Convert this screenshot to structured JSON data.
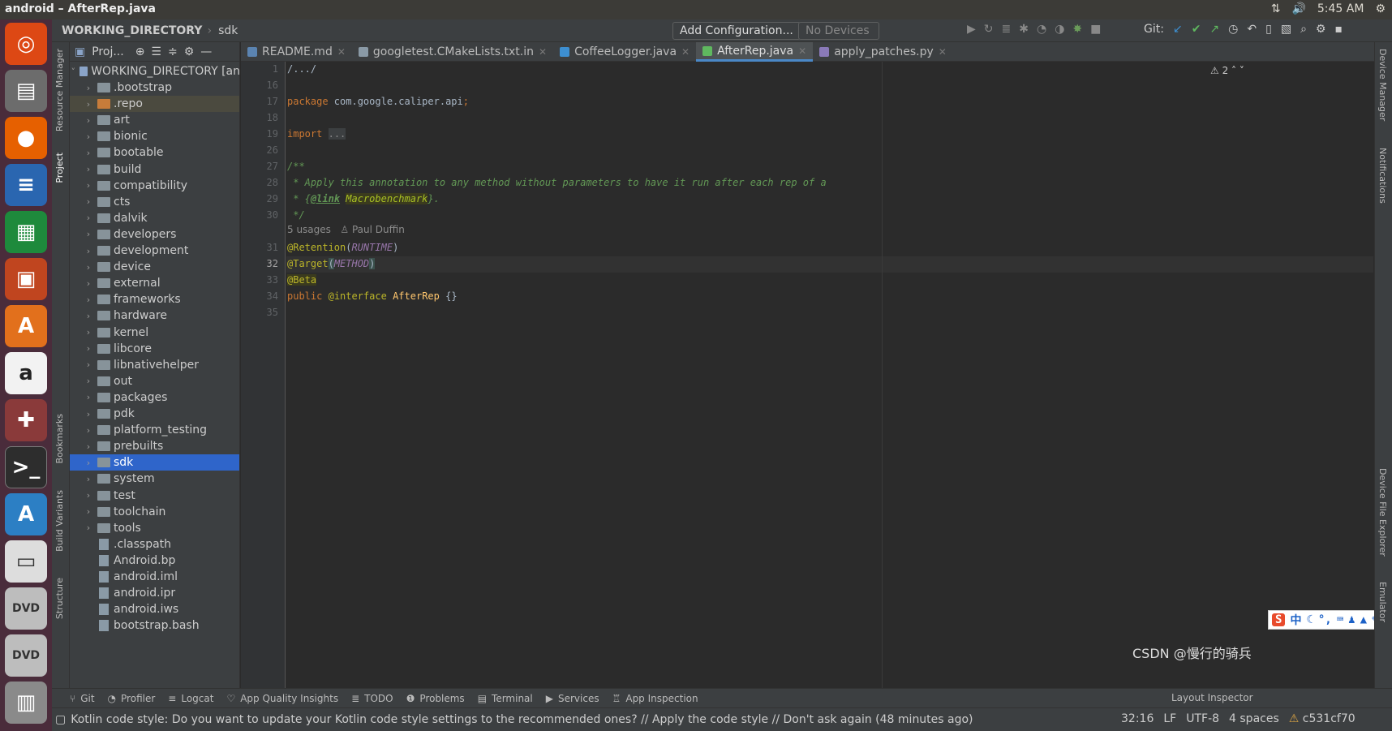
{
  "topbar": {
    "title": "android – AfterRep.java",
    "time": "5:45 AM"
  },
  "navbar": {
    "crumb_root": "WORKING_DIRECTORY",
    "crumb_child": "sdk",
    "add_config": "Add Configuration...",
    "devices": "No Devices",
    "git_label": "Git:"
  },
  "side": {
    "resource_manager": "Resource Manager",
    "project": "Project",
    "bookmarks": "Bookmarks",
    "build_variants": "Build Variants",
    "structure": "Structure",
    "device_manager": "Device Manager",
    "notifications": "Notifications",
    "device_file_explorer": "Device File Explorer",
    "emulator": "Emulator"
  },
  "project": {
    "header": "Proj...",
    "root": "WORKING_DIRECTORY [an",
    "items": [
      {
        "label": ".bootstrap",
        "type": "folder"
      },
      {
        "label": ".repo",
        "type": "folder-orange"
      },
      {
        "label": "art",
        "type": "folder"
      },
      {
        "label": "bionic",
        "type": "folder"
      },
      {
        "label": "bootable",
        "type": "folder"
      },
      {
        "label": "build",
        "type": "folder"
      },
      {
        "label": "compatibility",
        "type": "folder"
      },
      {
        "label": "cts",
        "type": "folder"
      },
      {
        "label": "dalvik",
        "type": "folder"
      },
      {
        "label": "developers",
        "type": "folder"
      },
      {
        "label": "development",
        "type": "folder"
      },
      {
        "label": "device",
        "type": "folder"
      },
      {
        "label": "external",
        "type": "folder"
      },
      {
        "label": "frameworks",
        "type": "folder"
      },
      {
        "label": "hardware",
        "type": "folder"
      },
      {
        "label": "kernel",
        "type": "folder"
      },
      {
        "label": "libcore",
        "type": "folder"
      },
      {
        "label": "libnativehelper",
        "type": "folder"
      },
      {
        "label": "out",
        "type": "folder"
      },
      {
        "label": "packages",
        "type": "folder"
      },
      {
        "label": "pdk",
        "type": "folder"
      },
      {
        "label": "platform_testing",
        "type": "folder"
      },
      {
        "label": "prebuilts",
        "type": "folder"
      },
      {
        "label": "sdk",
        "type": "folder"
      },
      {
        "label": "system",
        "type": "folder"
      },
      {
        "label": "test",
        "type": "folder"
      },
      {
        "label": "toolchain",
        "type": "folder"
      },
      {
        "label": "tools",
        "type": "folder"
      },
      {
        "label": ".classpath",
        "type": "file"
      },
      {
        "label": "Android.bp",
        "type": "file"
      },
      {
        "label": "android.iml",
        "type": "file"
      },
      {
        "label": "android.ipr",
        "type": "file"
      },
      {
        "label": "android.iws",
        "type": "file"
      },
      {
        "label": "bootstrap.bash",
        "type": "file"
      }
    ],
    "selected": "sdk"
  },
  "tabs": [
    {
      "label": "README.md",
      "active": false
    },
    {
      "label": "googletest.CMakeLists.txt.in",
      "active": false
    },
    {
      "label": "CoffeeLogger.java",
      "active": false
    },
    {
      "label": "AfterRep.java",
      "active": true
    },
    {
      "label": "apply_patches.py",
      "active": false
    }
  ],
  "editor": {
    "warnings": "2",
    "line_numbers": [
      "1",
      "16",
      "17",
      "18",
      "19",
      "26",
      "27",
      "28",
      "29",
      "30",
      "31",
      "32",
      "33",
      "34",
      "35"
    ],
    "code": {
      "l1": "/.../",
      "l17_kw": "package",
      "l17_rest": " com.google.caliper.api",
      "l17_semi": ";",
      "l19_kw": "import",
      "l19_rest": "...",
      "l27": "/**",
      "l28": " * Apply this annotation to any method without parameters to have it run after each rep of a",
      "l29_pre": " * {",
      "l29_tag": "@link",
      "l29_ref": "Macrobenchmark",
      "l29_post": "}.",
      "l30": " */",
      "usages": "5 usages",
      "author": "Paul Duffin",
      "l31_an": "@Retention",
      "l31_arg": "RUNTIME",
      "l32_an": "@Target",
      "l32_arg": "METHOD",
      "l33_an": "@Beta",
      "l34_kw": "public",
      "l34_an": "@interface",
      "l34_name": "AfterRep",
      "l34_body": "{}"
    }
  },
  "toolwindows": [
    "Git",
    "Profiler",
    "Logcat",
    "App Quality Insights",
    "TODO",
    "Problems",
    "Terminal",
    "Services",
    "App Inspection"
  ],
  "layout_inspector": "Layout Inspector",
  "status": {
    "message": "Kotlin code style: Do you want to update your Kotlin code style settings to the recommended ones? // Apply the code style // Don't ask again (48 minutes ago)",
    "position": "32:16",
    "line_sep": "LF",
    "encoding": "UTF-8",
    "indent": "4 spaces",
    "branch": "c531cf70"
  },
  "watermark": "CSDN @慢行的骑兵"
}
